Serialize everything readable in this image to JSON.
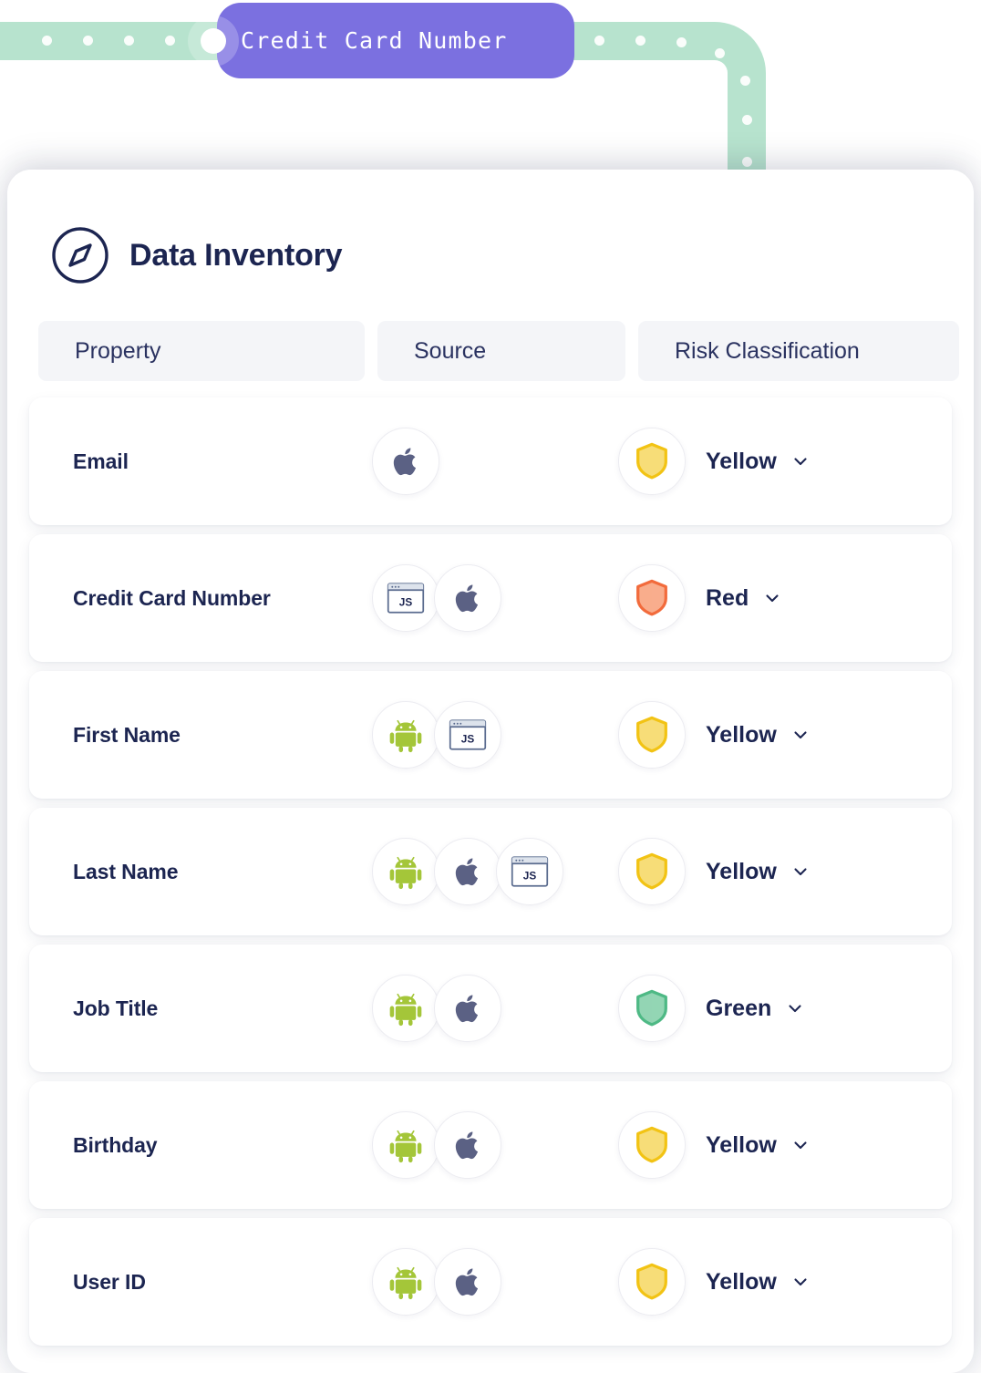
{
  "colors": {
    "mint_track": "#b7e3ce",
    "pill_purple": "#7b70e0",
    "navy_text": "#1c2551",
    "header_bg": "#f4f5f8",
    "risk_red": "#f26b3c",
    "risk_red_fill": "#f9ad8d",
    "risk_yellow": "#f2c314",
    "risk_yellow_fill": "#f7dd78",
    "risk_green": "#4eb985",
    "risk_green_fill": "#93d6b4",
    "android_green": "#a4c639",
    "apple_gray": "#5b6184",
    "js_window": "#5b6c8f"
  },
  "flow_badge": {
    "label": "Credit Card Number",
    "dot_icon": "flow-node-dot"
  },
  "header": {
    "icon": "compass-icon",
    "title": "Data Inventory"
  },
  "table": {
    "columns": [
      "Property",
      "Source",
      "Risk Classification"
    ],
    "rows": [
      {
        "property": "Email",
        "sources": [
          "apple"
        ],
        "risk": "Yellow"
      },
      {
        "property": "Credit Card Number",
        "sources": [
          "js",
          "apple"
        ],
        "risk": "Red"
      },
      {
        "property": "First Name",
        "sources": [
          "android",
          "js"
        ],
        "risk": "Yellow"
      },
      {
        "property": "Last Name",
        "sources": [
          "android",
          "apple",
          "js"
        ],
        "risk": "Yellow"
      },
      {
        "property": "Job Title",
        "sources": [
          "android",
          "apple"
        ],
        "risk": "Green"
      },
      {
        "property": "Birthday",
        "sources": [
          "android",
          "apple"
        ],
        "risk": "Yellow"
      },
      {
        "property": "User ID",
        "sources": [
          "android",
          "apple"
        ],
        "risk": "Yellow"
      }
    ],
    "source_icon_names": {
      "apple": "apple-icon",
      "android": "android-icon",
      "js": "js-browser-icon"
    },
    "js_icon_label": "JS",
    "risk_chevron_icon": "chevron-down-icon",
    "risk_shield_icon": "shield-icon"
  }
}
